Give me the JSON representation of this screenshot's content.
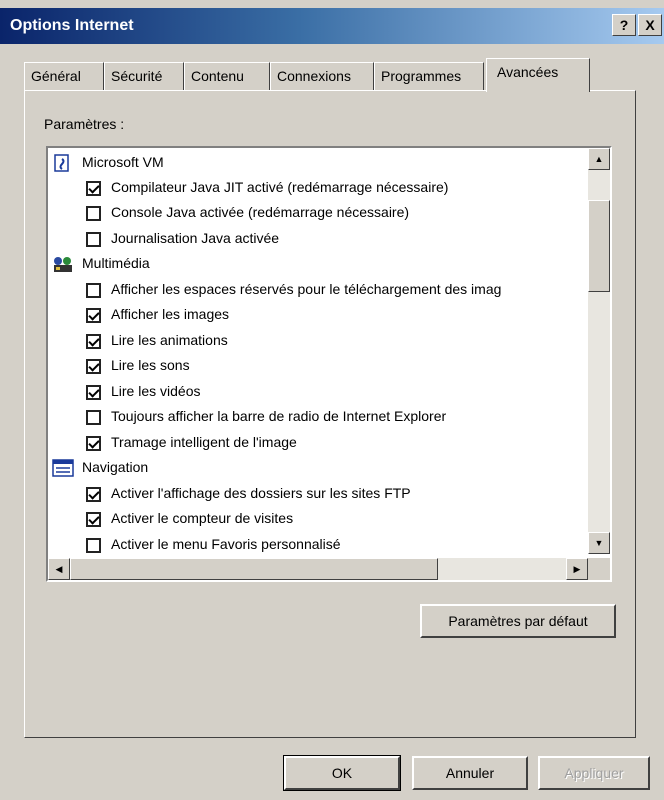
{
  "window": {
    "title": "Options Internet",
    "help_label": "?",
    "close_label": "X"
  },
  "tabs": [
    {
      "label": "Général",
      "active": false
    },
    {
      "label": "Sécurité",
      "active": false
    },
    {
      "label": "Contenu",
      "active": false
    },
    {
      "label": "Connexions",
      "active": false
    },
    {
      "label": "Programmes",
      "active": false
    },
    {
      "label": "Avancées",
      "active": true
    }
  ],
  "settings": {
    "label": "Paramètres :",
    "categories": [
      {
        "name": "Microsoft VM",
        "icon": "microsoft-vm-icon",
        "options": [
          {
            "label": "Compilateur Java JIT activé (redémarrage nécessaire)",
            "checked": true
          },
          {
            "label": "Console Java activée (redémarrage nécessaire)",
            "checked": false
          },
          {
            "label": "Journalisation Java activée",
            "checked": false
          }
        ]
      },
      {
        "name": "Multimédia",
        "icon": "multimedia-icon",
        "options": [
          {
            "label": "Afficher les espaces réservés pour le téléchargement des imag",
            "checked": false
          },
          {
            "label": "Afficher les images",
            "checked": true
          },
          {
            "label": "Lire les animations",
            "checked": true
          },
          {
            "label": "Lire les sons",
            "checked": true
          },
          {
            "label": "Lire les vidéos",
            "checked": true
          },
          {
            "label": "Toujours afficher la barre de radio de Internet Explorer",
            "checked": false
          },
          {
            "label": "Tramage intelligent de l'image",
            "checked": true
          }
        ]
      },
      {
        "name": "Navigation",
        "icon": "navigation-icon",
        "options": [
          {
            "label": "Activer l'affichage des dossiers sur les sites FTP",
            "checked": true
          },
          {
            "label": "Activer le compteur de visites",
            "checked": true
          },
          {
            "label": "Activer le menu Favoris personnalisé",
            "checked": false
          }
        ]
      }
    ]
  },
  "buttons": {
    "restore_defaults": "Paramètres par défaut",
    "ok": "OK",
    "cancel": "Annuler",
    "apply": "Appliquer"
  },
  "colors": {
    "dialog_face": "#d4d0c8",
    "titlebar_start": "#0a246a",
    "titlebar_end": "#a6caf0"
  }
}
